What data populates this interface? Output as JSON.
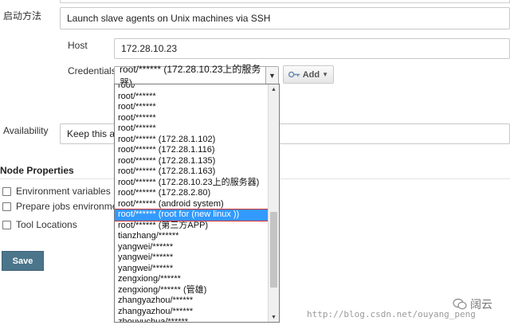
{
  "form": {
    "launch_method": {
      "label": "启动方法",
      "value": "Launch slave agents on Unix machines via SSH"
    },
    "host": {
      "label": "Host",
      "value": "172.28.10.23"
    },
    "credentials": {
      "label": "Credentials",
      "selected": "root/****** (172.28.10.23上的服务器)",
      "add_label": "Add",
      "options": [
        "root/",
        "root/******",
        "root/******",
        "root/******",
        "root/******",
        "root/****** (172.28.1.102)",
        "root/****** (172.28.1.116)",
        "root/****** (172.28.1.135)",
        "root/****** (172.28.1.163)",
        "root/****** (172.28.10.23上的服务器)",
        "root/****** (172.28.2.80)",
        "root/****** (android system)",
        "root/****** (root for (new linux ))",
        "root/****** (第三方APP)",
        "tianzhang/******",
        "yangwei/******",
        "yangwei/******",
        "yangwei/******",
        "zengxiong/******",
        "zengxiong/****** (管雄)",
        "zhangyazhou/******",
        "zhangyazhou/******",
        "zhouyuchua/******"
      ],
      "highlighted_index": 12
    },
    "availability": {
      "label": "Availability",
      "value": "Keep this ag"
    }
  },
  "node_properties": {
    "title": "Node Properties",
    "items": [
      {
        "label": "Environment variables"
      },
      {
        "label": "Prepare jobs environment"
      },
      {
        "label": "Tool Locations"
      }
    ]
  },
  "save_label": "Save",
  "watermark": "http://blog.csdn.net/ouyang_peng",
  "brand": "阔云"
}
